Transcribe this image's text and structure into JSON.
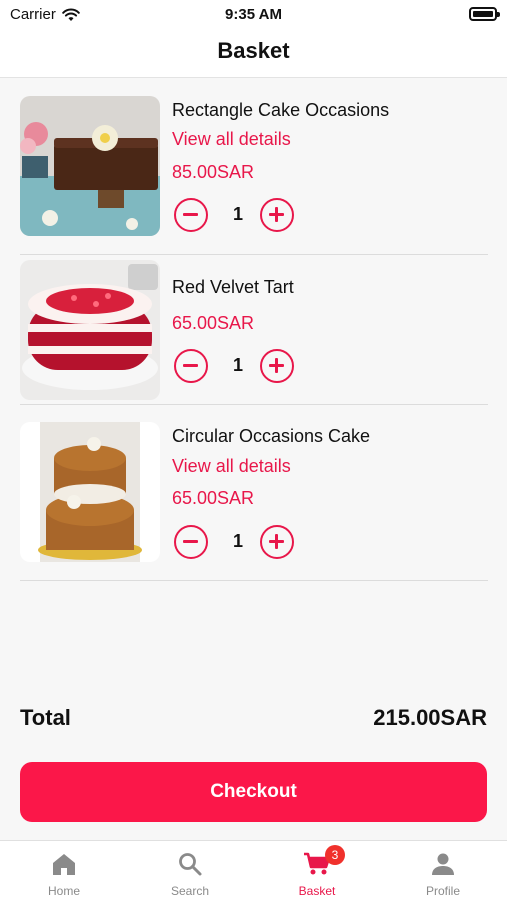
{
  "status_bar": {
    "carrier": "Carrier",
    "time": "9:35 AM"
  },
  "header": {
    "title": "Basket"
  },
  "basket": {
    "items": [
      {
        "name": "Rectangle Cake Occasions",
        "details_link": "View all details",
        "price": "85.00SAR",
        "quantity": "1",
        "image": "rectangle-chocolate-cake-photo"
      },
      {
        "name": "Red Velvet Tart",
        "price": "65.00SAR",
        "quantity": "1",
        "image": "red-velvet-cake-photo"
      },
      {
        "name": "Circular Occasions Cake",
        "details_link": "View all details",
        "price": "65.00SAR",
        "quantity": "1",
        "image": "caramel-round-cakes-photo"
      }
    ],
    "total_label": "Total",
    "total_value": "215.00SAR",
    "checkout_label": "Checkout"
  },
  "tab_bar": {
    "tabs": [
      {
        "label": "Home",
        "icon": "home-icon",
        "active": false
      },
      {
        "label": "Search",
        "icon": "search-icon",
        "active": false
      },
      {
        "label": "Basket",
        "icon": "cart-icon",
        "active": true,
        "badge": "3"
      },
      {
        "label": "Profile",
        "icon": "person-icon",
        "active": false
      }
    ]
  },
  "colors": {
    "accent": "#e8174a",
    "checkout": "#fb1749",
    "badge": "#f0312c",
    "inactive": "#8a8a8a"
  }
}
